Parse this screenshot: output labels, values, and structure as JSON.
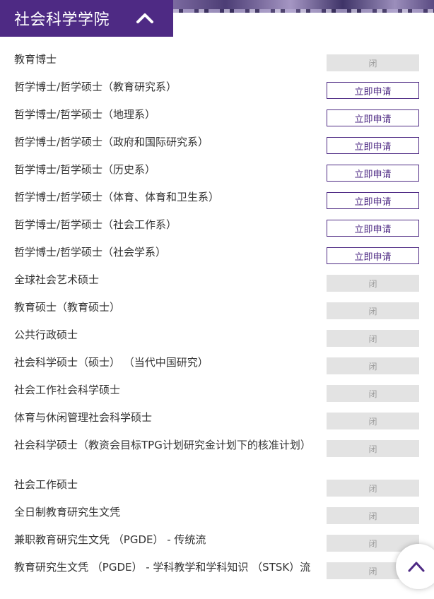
{
  "header": {
    "title": "社会科学学院"
  },
  "programs": [
    {
      "name": "教育博士",
      "status": "闭",
      "open": false
    },
    {
      "name": "哲学博士/哲学硕士（教育研究系）",
      "status": "立即申请",
      "open": true
    },
    {
      "name": "哲学博士/哲学硕士（地理系）",
      "status": "立即申请",
      "open": true
    },
    {
      "name": "哲学博士/哲学硕士（政府和国际研究系）",
      "status": "立即申请",
      "open": true
    },
    {
      "name": "哲学博士/哲学硕士（历史系）",
      "status": "立即申请",
      "open": true
    },
    {
      "name": "哲学博士/哲学硕士（体育、体育和卫生系）",
      "status": "立即申请",
      "open": true
    },
    {
      "name": "哲学博士/哲学硕士（社会工作系）",
      "status": "立即申请",
      "open": true
    },
    {
      "name": "哲学博士/哲学硕士（社会学系）",
      "status": "立即申请",
      "open": true
    },
    {
      "name": "全球社会艺术硕士",
      "status": "闭",
      "open": false
    },
    {
      "name": "教育硕士（教育硕士）",
      "status": "闭",
      "open": false
    },
    {
      "name": "公共行政硕士",
      "status": "闭",
      "open": false
    },
    {
      "name": "社会科学硕士（硕士） （当代中国研究）",
      "status": "闭",
      "open": false
    },
    {
      "name": "社会工作社会科学硕士",
      "status": "闭",
      "open": false
    },
    {
      "name": "体育与休闲管理社会科学硕士",
      "status": "闭",
      "open": false
    },
    {
      "name": "社会科学硕士（教资会目标TPG计划研究金计划下的核准计划）",
      "status": "闭",
      "open": false
    },
    {
      "name": "社会工作硕士",
      "status": "闭",
      "open": false
    },
    {
      "name": "全日制教育研究生文凭",
      "status": "闭",
      "open": false
    },
    {
      "name": "兼职教育研究生文凭 （PGDE） - 传统流",
      "status": "闭",
      "open": false
    },
    {
      "name": "教育研究生文凭 （PGDE） - 学科教学和学科知识 （STSK）流",
      "status": "闭",
      "open": false
    }
  ],
  "colors": {
    "brand": "#4e2a84",
    "closed_bg": "#e3e3e3",
    "closed_text": "#9c9c9c"
  },
  "icons": {
    "header_toggle": "chevron-up-icon",
    "scroll_top": "chevron-up-icon"
  }
}
